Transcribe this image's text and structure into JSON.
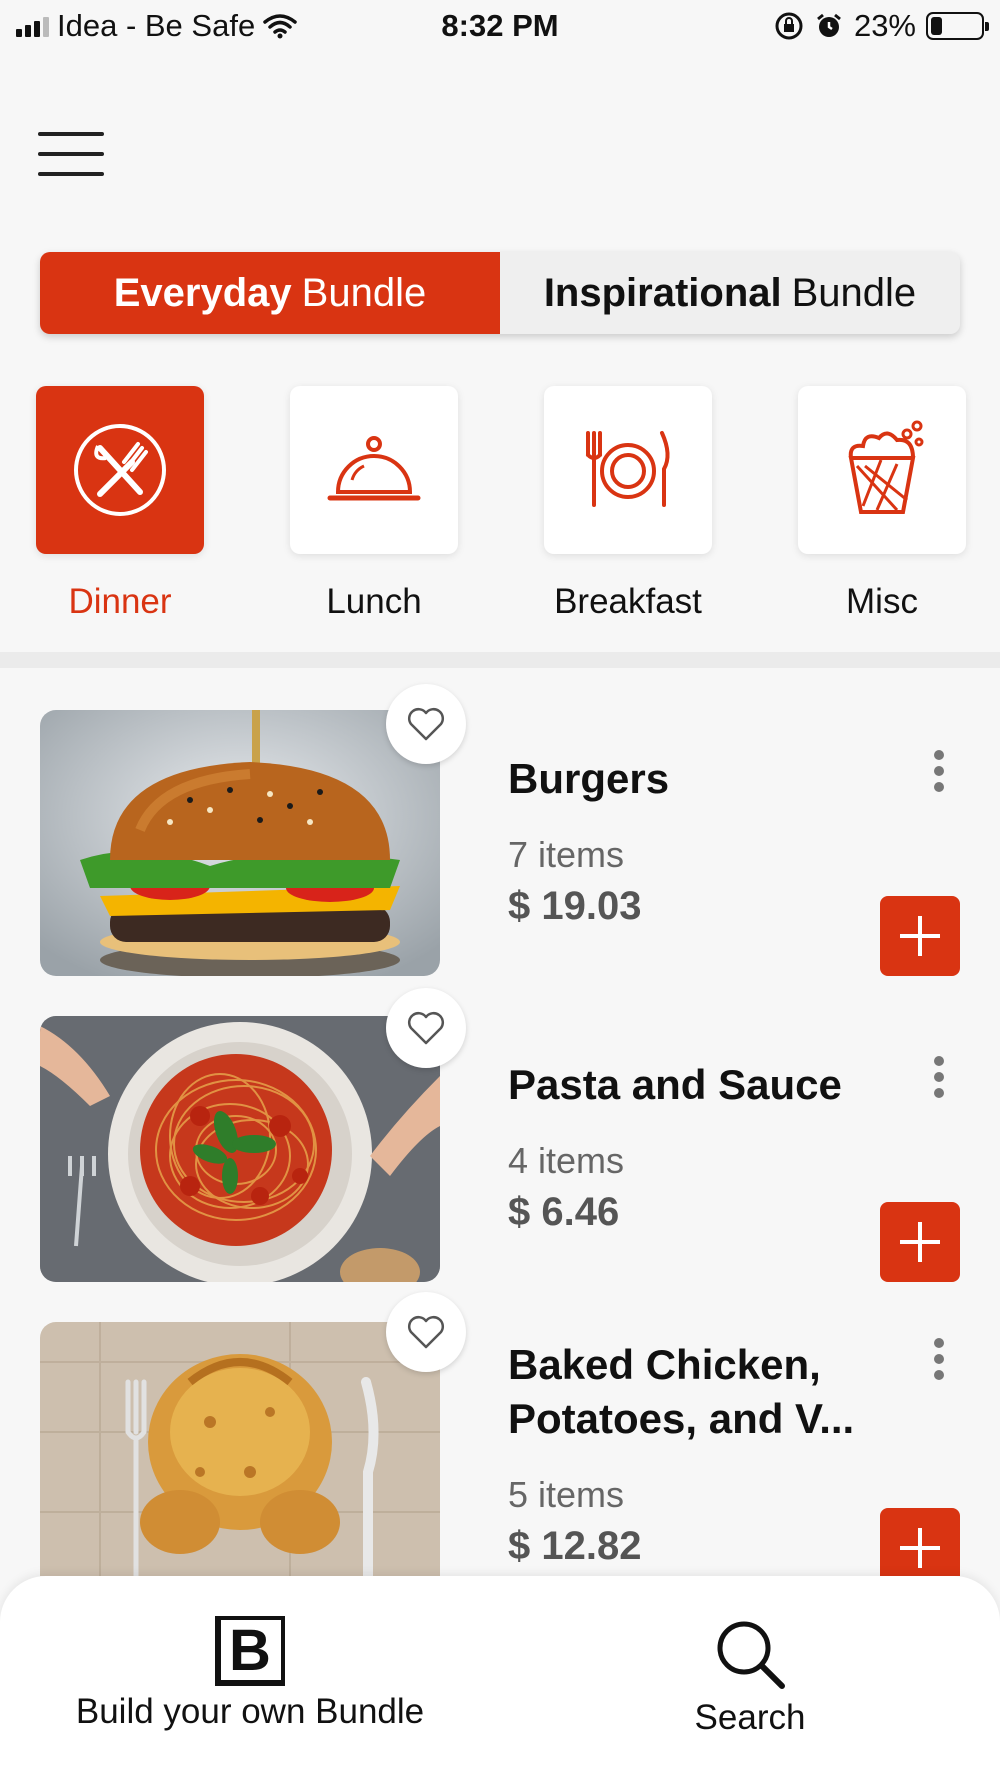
{
  "status": {
    "carrier": "Idea - Be Safe",
    "time": "8:32 PM",
    "battery": "23%",
    "battery_level": 0.23,
    "icons": [
      "signal-icon",
      "wifi-icon",
      "rotation-lock-icon",
      "alarm-icon",
      "battery-icon"
    ]
  },
  "menu_icon": "hamburger-menu-icon",
  "toggle": {
    "everyday_bold": "Everyday",
    "everyday_rest": "Bundle",
    "inspirational_bold": "Inspirational",
    "inspirational_rest": "Bundle",
    "active": "everyday"
  },
  "categories": [
    {
      "label": "Dinner",
      "icon": "fork-knife-icon",
      "active": true
    },
    {
      "label": "Lunch",
      "icon": "cloche-icon",
      "active": false
    },
    {
      "label": "Breakfast",
      "icon": "plate-cutlery-icon",
      "active": false
    },
    {
      "label": "Misc",
      "icon": "popcorn-icon",
      "active": false
    }
  ],
  "bundles": [
    {
      "title": "Burgers",
      "count": "7 items",
      "price": "$ 19.03",
      "image": "burger-photo"
    },
    {
      "title": "Pasta and Sauce",
      "count": "4 items",
      "price": "$ 6.46",
      "image": "pasta-photo"
    },
    {
      "title_line1": "Baked Chicken,",
      "title_line2": "Potatoes, and V...",
      "count": "5 items",
      "price": "$ 12.82",
      "image": "chicken-photo"
    }
  ],
  "bottom_nav": {
    "build_label": "Build your own Bundle",
    "build_icon_letter": "B",
    "search_label": "Search"
  },
  "colors": {
    "accent": "#d93412",
    "background": "#f7f7f7"
  }
}
